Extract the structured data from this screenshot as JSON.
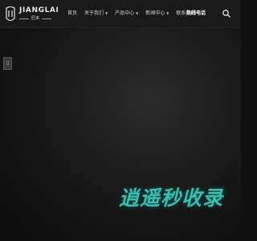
{
  "brand": {
    "name": "JIANGLAI",
    "sub": "匠来"
  },
  "nav": {
    "items": [
      {
        "label": "首页",
        "has_dropdown": false
      },
      {
        "label": "关于我们",
        "has_dropdown": true
      },
      {
        "label": "产品中心",
        "has_dropdown": true
      },
      {
        "label": "新闻中心",
        "has_dropdown": true
      },
      {
        "label": "联系我们",
        "has_dropdown": false
      }
    ]
  },
  "hotline": {
    "label": "热线电话"
  },
  "search": {
    "icon": "search-icon"
  },
  "side_float": {
    "icon": "page-icon",
    "glyph": "▯"
  },
  "hero": {
    "slogan": "逍遥秒收录"
  },
  "colors": {
    "accent": "#2fc1b1",
    "header_bg": "#1a1a1a",
    "page_bg": "#121212"
  }
}
